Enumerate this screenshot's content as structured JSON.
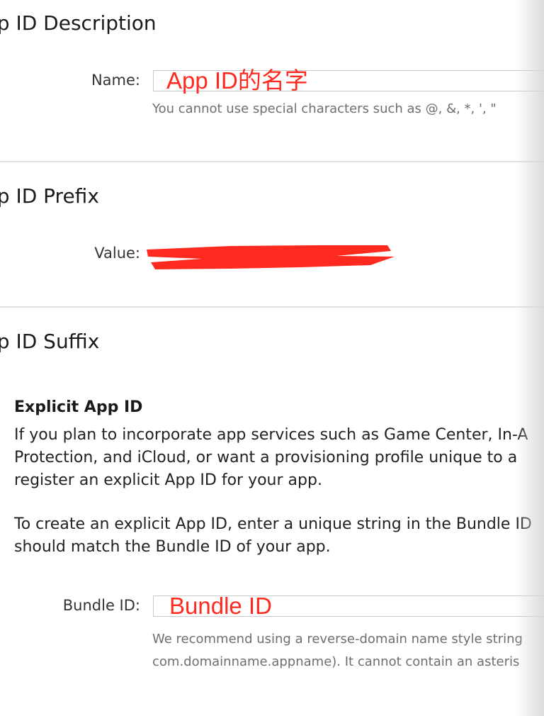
{
  "description": {
    "heading": "pp ID Description",
    "name_label": "Name:",
    "name_value": "App ID的名字",
    "name_hint": "You cannot use special characters such as @, &, *, ', \""
  },
  "prefix": {
    "heading": "pp ID Prefix",
    "value_label": "Value:"
  },
  "suffix": {
    "heading": "pp ID Suffix",
    "explicit_title": "Explicit App ID",
    "para1_line1": "If you plan to incorporate app services such as Game Center, In-A",
    "para1_line2": "Protection, and iCloud, or want a provisioning profile unique to a",
    "para1_line3": "register an explicit App ID for your app.",
    "para2_line1": "To create an explicit App ID, enter a unique string in the Bundle ID",
    "para2_line2": "should match the Bundle ID of your app.",
    "bundle_label": "Bundle ID:",
    "bundle_value": "Bundle ID",
    "bundle_hint_line1": "We recommend using a reverse-domain name style string",
    "bundle_hint_line2": "com.domainname.appname). It cannot contain an asteris"
  },
  "colors": {
    "annotation_red": "#ff2a1f",
    "hint_gray": "#6e6e6e",
    "divider": "#e2e2e2"
  }
}
